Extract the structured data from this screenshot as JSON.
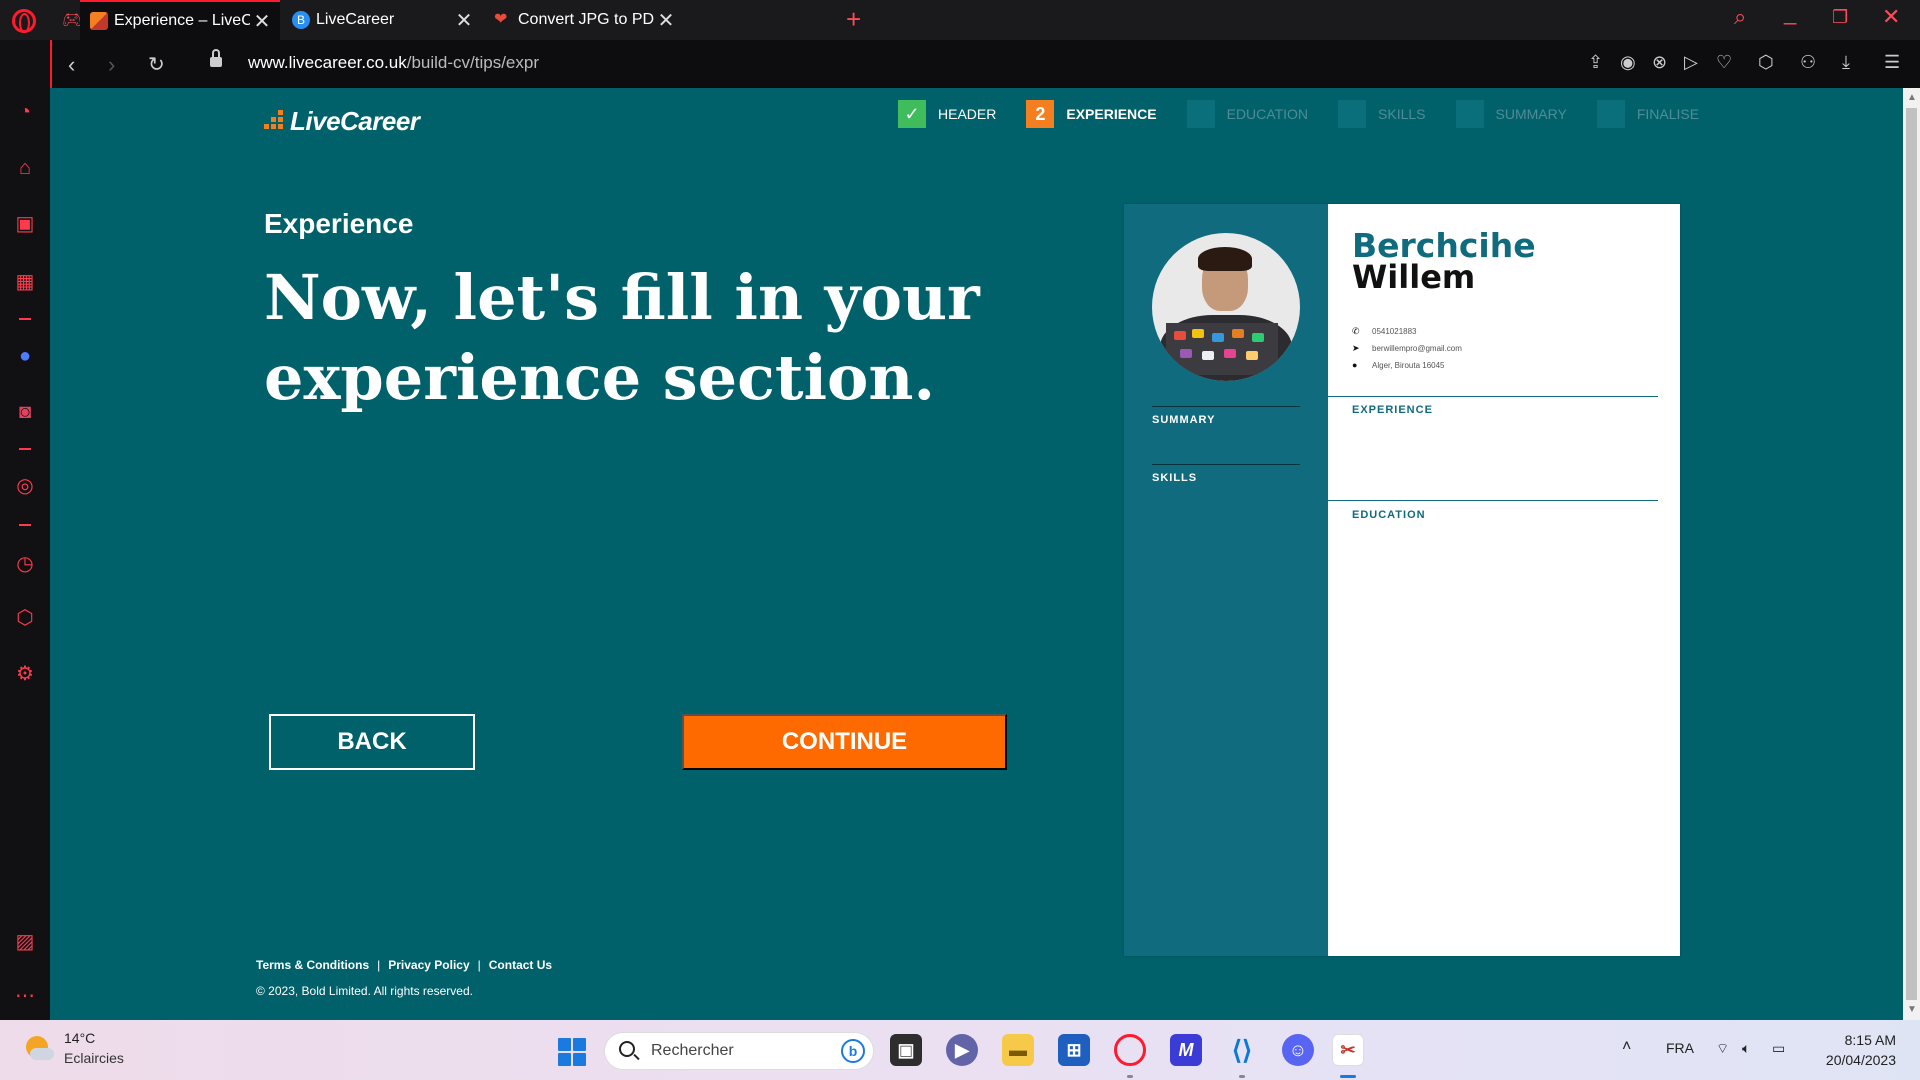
{
  "browser": {
    "tabs": [
      {
        "title": "Experience – LiveCareer",
        "active": true
      },
      {
        "title": "LiveCareer",
        "active": false
      },
      {
        "title": "Convert JPG to PDF. Image",
        "active": false
      }
    ],
    "url_host": "www.livecareer.co.uk",
    "url_path": "/build-cv/tips/expr"
  },
  "brand": {
    "name": "LiveCareer",
    "accent_color": "#f47f20",
    "bg_color": "#00616b",
    "cta_color": "#ff6a00"
  },
  "steps": [
    {
      "label": "HEADER",
      "state": "done"
    },
    {
      "label": "EXPERIENCE",
      "state": "current",
      "number": "2"
    },
    {
      "label": "EDUCATION",
      "state": "todo"
    },
    {
      "label": "SKILLS",
      "state": "todo"
    },
    {
      "label": "SUMMARY",
      "state": "todo"
    },
    {
      "label": "FINALISE",
      "state": "todo"
    }
  ],
  "main": {
    "section_label": "Experience",
    "headline": "Now, let's fill in your experience section.",
    "back_label": "BACK",
    "continue_label": "CONTINUE"
  },
  "footer": {
    "terms": "Terms & Conditions",
    "privacy": "Privacy Policy",
    "contact": "Contact Us",
    "separator": "|",
    "copyright": "© 2023, Bold Limited. All rights reserved."
  },
  "cv": {
    "first_name": "Berchcihe",
    "last_name": "Willem",
    "phone": "0541021883",
    "email": "berwillempro@gmail.com",
    "address": "Alger, Birouta 16045",
    "side_sections": [
      "SUMMARY",
      "SKILLS"
    ],
    "main_sections": [
      "EXPERIENCE",
      "EDUCATION"
    ]
  },
  "taskbar": {
    "weather_temp": "14°C",
    "weather_desc": "Eclaircies",
    "search_placeholder": "Rechercher",
    "language": "FRA",
    "time": "8:15 AM",
    "date": "20/04/2023"
  }
}
